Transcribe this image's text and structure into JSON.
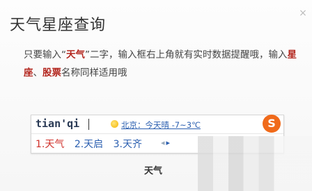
{
  "window": {
    "title": "天气星座查询",
    "close_symbol": "×"
  },
  "description": {
    "part1": "只要输入“",
    "keyword1": "天气",
    "part2": "”二字，输入框右上角就有实时数据提醒哦，输入",
    "keyword2": "星座",
    "sep": "、",
    "keyword3": "股票",
    "part3": "名称同样适用哦"
  },
  "ime": {
    "pinyin": "tian'qi",
    "weather_text": "北京：今天晴 -7~3℃",
    "logo_letter": "S",
    "candidates": [
      {
        "label": "1.天气",
        "selected": true
      },
      {
        "label": "2.天启",
        "selected": false
      },
      {
        "label": "3.天齐",
        "selected": false
      }
    ],
    "prev_symbol": "◂",
    "next_symbol": "▸"
  },
  "caption": "天气",
  "colors": {
    "highlight": "#b3261e",
    "candidate": "#2b5fb0",
    "candidate_selected": "#d0302a",
    "logo": "#f06a1a"
  },
  "icons": [
    "close-icon",
    "sun-icon",
    "sogou-logo-icon",
    "prev-page-icon",
    "next-page-icon"
  ]
}
